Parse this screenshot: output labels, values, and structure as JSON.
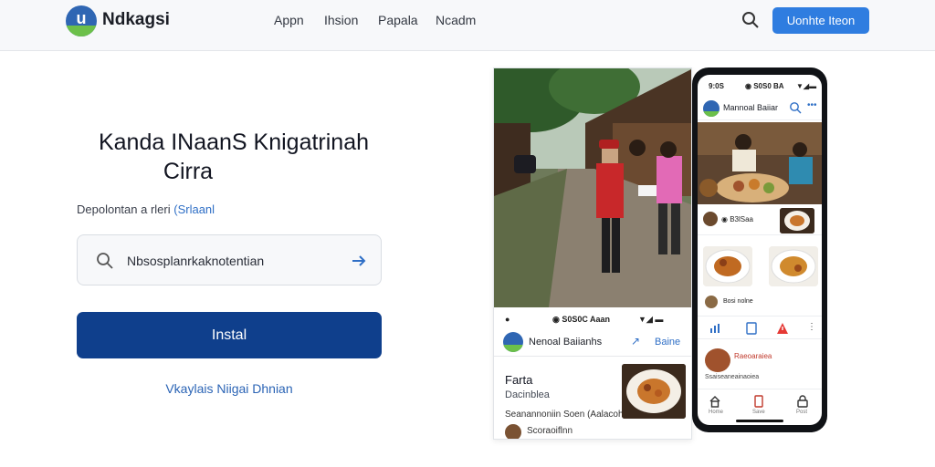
{
  "header": {
    "logo_letter": "u",
    "brand": "Ndkagsi",
    "nav": [
      "Appn",
      "Ihsion",
      "Papala",
      "Ncadm"
    ],
    "cta_label": "Uonhte Iteon"
  },
  "hero": {
    "headline_line1": "Kanda INaanS Knigatrinah",
    "headline_line2": "Cirra",
    "sub_text": "Depolontan a rleri",
    "sub_link": "(Srlaanl",
    "search_value": "Nbsosplanrkaknotentian",
    "install_label": "Instal",
    "secondary_link": "Vkaylais Niigai Dhnian"
  },
  "photo_card": {
    "status_time": "◉ S0S0C Aaan",
    "status_left": "●",
    "status_right": "▼◢ ▬",
    "app_name": "Nenoal Baiianhs",
    "share_icon": "↗",
    "share_label": "Baine",
    "post_title": "Farta",
    "post_subtitle": "Dacinblea",
    "post_line": "Seanannoniin Soen (Aalacohias",
    "post_author": "Scoraoiflnn"
  },
  "phone": {
    "status_left": "9:0S",
    "status_mid": "◉ S0S0 BA",
    "status_right": "▼◢▬",
    "app_name": "Mannoal Baiiar",
    "more_icon": "•••",
    "row1_text": "◉ B3lSaa",
    "row2_text": "Bosi nolne",
    "post_title": "Raeoaraiea",
    "post_meta": "Ssaiseaneainaoiea",
    "tabs": [
      "Home",
      "Save",
      "Cont",
      "Post"
    ]
  },
  "colors": {
    "brand_blue": "#2f66b3",
    "brand_green": "#6cc04a",
    "cta_blue": "#2f7de0",
    "install_navy": "#0f3f8c",
    "link_blue": "#2b64b5"
  }
}
